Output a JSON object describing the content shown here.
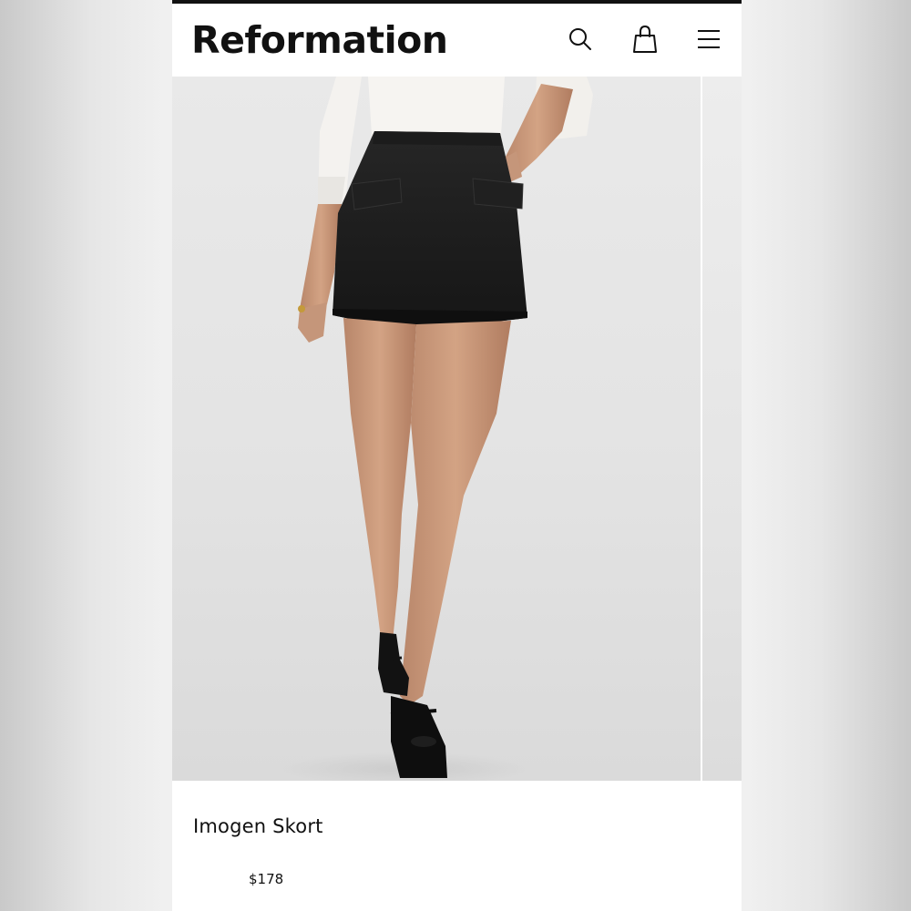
{
  "header": {
    "logo_text": "Reformation",
    "icons": {
      "search": "search-icon",
      "bag": "shopping-bag-icon",
      "menu": "hamburger-menu-icon"
    }
  },
  "gallery": {
    "image_description": "Model wearing black mini skort with flap pockets, white shirt and black Mary Jane flats"
  },
  "product": {
    "name": "Imogen Skort",
    "price": "$178"
  },
  "colors": {
    "accent": "#111111",
    "background": "#ffffff",
    "photo_backdrop": "#e4e4e4"
  }
}
